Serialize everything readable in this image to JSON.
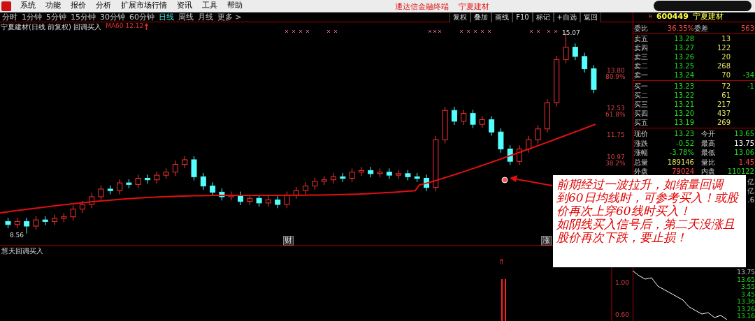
{
  "menu": {
    "items": [
      "系统",
      "功能",
      "报价",
      "分析",
      "扩展市场行情",
      "资讯",
      "工具",
      "帮助"
    ]
  },
  "title_bar": {
    "app": "通达信金融终端",
    "stock": "宁夏建材"
  },
  "periods": [
    {
      "label": "分时",
      "selected": false
    },
    {
      "label": "1分钟",
      "selected": false
    },
    {
      "label": "5分钟",
      "selected": false
    },
    {
      "label": "15分钟",
      "selected": false
    },
    {
      "label": "30分钟",
      "selected": false
    },
    {
      "label": "60分钟",
      "selected": false
    },
    {
      "label": "日线",
      "selected": true
    },
    {
      "label": "周线",
      "selected": false
    },
    {
      "label": "月线",
      "selected": false
    },
    {
      "label": "更多 >",
      "selected": false
    }
  ],
  "toolbar_buttons": [
    "复权",
    "叠加",
    "画线",
    "F10",
    "标记",
    "+自选",
    "返回"
  ],
  "chart": {
    "title": "宁夏建材(日线 前复权) 回调买入",
    "ma_label": "MA60 12.12",
    "high_label": "15.07",
    "low_label": "8.56",
    "price_levels": [
      {
        "price": "13.80",
        "ratio": "80.9%"
      },
      {
        "price": "12.53",
        "ratio": "61.8%"
      },
      {
        "price": "11.75"
      },
      {
        "price": "10.97",
        "ratio": "38.2%"
      }
    ],
    "markers": [
      "财",
      "涨"
    ],
    "chart_data": {
      "type": "candlestick",
      "ohlc": [
        [
          8.95,
          9.07,
          8.73,
          8.85
        ],
        [
          8.85,
          9.07,
          8.73,
          8.95
        ],
        [
          8.95,
          9.07,
          8.56,
          8.8
        ],
        [
          8.8,
          9.12,
          8.68,
          9.0
        ],
        [
          9.0,
          9.12,
          8.83,
          8.95
        ],
        [
          8.95,
          9.17,
          8.83,
          9.05
        ],
        [
          9.05,
          9.22,
          8.93,
          9.1
        ],
        [
          9.1,
          9.47,
          8.98,
          9.35
        ],
        [
          9.35,
          9.62,
          9.23,
          9.5
        ],
        [
          9.5,
          9.87,
          9.38,
          9.75
        ],
        [
          9.75,
          10.12,
          9.63,
          10.0
        ],
        [
          10.0,
          10.12,
          9.83,
          9.95
        ],
        [
          9.95,
          10.32,
          9.83,
          10.2
        ],
        [
          10.2,
          10.32,
          10.03,
          10.15
        ],
        [
          10.15,
          10.47,
          10.03,
          10.35
        ],
        [
          10.35,
          10.47,
          10.18,
          10.3
        ],
        [
          10.3,
          10.57,
          10.18,
          10.45
        ],
        [
          10.45,
          10.67,
          10.33,
          10.55
        ],
        [
          10.55,
          10.92,
          10.43,
          10.8
        ],
        [
          10.8,
          11.07,
          10.68,
          10.95
        ],
        [
          10.95,
          11.07,
          10.28,
          10.4
        ],
        [
          10.4,
          10.52,
          9.98,
          10.1
        ],
        [
          10.1,
          10.22,
          9.78,
          9.9
        ],
        [
          9.9,
          10.02,
          9.63,
          9.75
        ],
        [
          9.75,
          9.92,
          9.63,
          9.8
        ],
        [
          9.8,
          9.92,
          9.48,
          9.6
        ],
        [
          9.6,
          9.82,
          9.48,
          9.7
        ],
        [
          9.7,
          9.82,
          9.43,
          9.55
        ],
        [
          9.55,
          9.77,
          9.43,
          9.65
        ],
        [
          9.65,
          9.77,
          9.38,
          9.5
        ],
        [
          9.5,
          9.92,
          9.38,
          9.8
        ],
        [
          9.8,
          10.07,
          9.68,
          9.95
        ],
        [
          9.95,
          10.22,
          9.83,
          10.1
        ],
        [
          10.1,
          10.37,
          9.98,
          10.25
        ],
        [
          10.25,
          10.42,
          10.13,
          10.3
        ],
        [
          10.3,
          10.52,
          10.18,
          10.4
        ],
        [
          10.4,
          10.52,
          10.23,
          10.35
        ],
        [
          10.35,
          10.67,
          10.23,
          10.55
        ],
        [
          10.55,
          10.72,
          10.43,
          10.6
        ],
        [
          10.6,
          10.72,
          10.38,
          10.5
        ],
        [
          10.5,
          10.67,
          10.38,
          10.55
        ],
        [
          10.55,
          10.67,
          10.33,
          10.45
        ],
        [
          10.45,
          10.62,
          10.33,
          10.5
        ],
        [
          10.5,
          10.62,
          10.28,
          10.4
        ],
        [
          10.4,
          10.52,
          10.23,
          10.35
        ],
        [
          10.35,
          10.47,
          9.93,
          10.05
        ],
        [
          10.05,
          11.72,
          9.93,
          11.6
        ],
        [
          11.6,
          12.67,
          11.48,
          12.55
        ],
        [
          12.55,
          12.67,
          12.08,
          12.2
        ],
        [
          12.2,
          12.57,
          12.08,
          12.45
        ],
        [
          12.45,
          12.57,
          11.98,
          12.1
        ],
        [
          12.1,
          12.37,
          11.98,
          12.25
        ],
        [
          12.25,
          12.37,
          11.73,
          11.85
        ],
        [
          11.85,
          11.97,
          11.18,
          11.3
        ],
        [
          11.3,
          11.42,
          10.78,
          10.9
        ],
        [
          10.9,
          11.42,
          10.78,
          11.3
        ],
        [
          11.3,
          11.72,
          11.18,
          11.6
        ],
        [
          11.6,
          12.07,
          11.48,
          11.95
        ],
        [
          11.95,
          12.92,
          11.83,
          12.8
        ],
        [
          12.8,
          14.32,
          12.68,
          14.2
        ],
        [
          14.2,
          15.07,
          14.08,
          14.6
        ],
        [
          14.6,
          14.72,
          14.18,
          14.3
        ],
        [
          14.3,
          14.42,
          13.78,
          13.9
        ],
        [
          13.9,
          14.02,
          13.11,
          13.23
        ]
      ]
    }
  },
  "indicator": {
    "title": "慧天回调买入",
    "signal": "⇑",
    "axis": [
      "1.00",
      "0.60"
    ]
  },
  "mini_chart": {
    "axis": [
      "13.75",
      "13.65",
      "3.55",
      "3.45",
      "13.36",
      "13.26",
      "13.16"
    ]
  },
  "quote": {
    "flag": "R",
    "code": "600449",
    "name": "宁夏建材",
    "ratio": {
      "label": "委比",
      "value": "36.35%",
      "diff_label": "委差",
      "diff": "563"
    },
    "asks": [
      {
        "label": "卖五",
        "price": "13.28",
        "volume": "13"
      },
      {
        "label": "卖四",
        "price": "13.27",
        "volume": "122"
      },
      {
        "label": "卖三",
        "price": "13.26",
        "volume": "20"
      },
      {
        "label": "卖二",
        "price": "13.25",
        "volume": "268"
      },
      {
        "label": "卖一",
        "price": "13.24",
        "volume": "70",
        "change": "-34"
      }
    ],
    "bids": [
      {
        "label": "买一",
        "price": "13.23",
        "volume": "72",
        "change": "-1"
      },
      {
        "label": "买二",
        "price": "13.22",
        "volume": "61"
      },
      {
        "label": "买三",
        "price": "13.21",
        "volume": "217"
      },
      {
        "label": "买四",
        "price": "13.20",
        "volume": "437"
      },
      {
        "label": "买五",
        "price": "13.19",
        "volume": "269"
      }
    ],
    "stats": [
      {
        "left": {
          "label": "现价",
          "value": "13.23",
          "color": "#22dd22"
        },
        "right": {
          "label": "今开",
          "value": "13.65",
          "color": "#22dd22"
        }
      },
      {
        "left": {
          "label": "涨跌",
          "value": "-0.52",
          "color": "#22dd22"
        },
        "right": {
          "label": "最高",
          "value": "13.75",
          "color": "#ffffff"
        }
      },
      {
        "left": {
          "label": "涨幅",
          "value": "-3.78%",
          "color": "#22dd22"
        },
        "right": {
          "label": "最低",
          "value": "13.06",
          "color": "#22dd22"
        }
      },
      {
        "left": {
          "label": "总量",
          "value": "189146",
          "color": "#e0e060"
        },
        "right": {
          "label": "量比",
          "value": "1.45",
          "color": "#ff4444"
        }
      },
      {
        "left": {
          "label": "外盘",
          "value": "79024",
          "color": "#ff4444"
        },
        "right": {
          "label": "内盘",
          "value": "110122",
          "color": "#22dd22"
        }
      }
    ],
    "covered_values": [
      "亿",
      "亿",
      ".6"
    ]
  },
  "note": {
    "lines": [
      "前期经过一波拉升，如缩量回调",
      "到60日均线时，可参考买入！或股",
      "价再次上穿60线时买入！",
      "如阴线买入信号后，第二天没涨且",
      "股价再次下跌，要止损！"
    ]
  }
}
